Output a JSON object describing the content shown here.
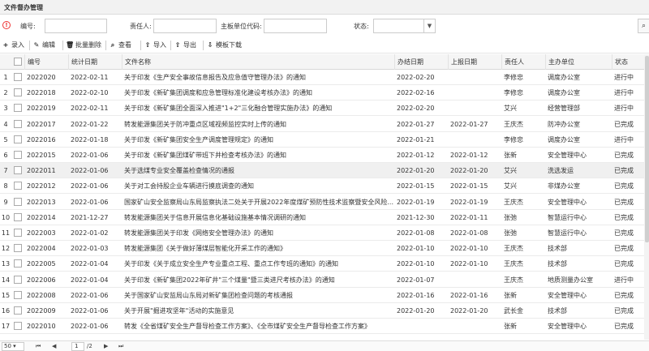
{
  "title": "文件督办管理",
  "filters": {
    "no_label": "编号:",
    "owner_label": "责任人:",
    "unit_code_label": "主板单位代码:",
    "status_label": "状态:"
  },
  "toolbar": {
    "add": "录入",
    "edit": "编辑",
    "batch_delete": "批量删除",
    "view": "查看",
    "import": "导入",
    "export": "导出",
    "template": "模板下载"
  },
  "columns": [
    "编号",
    "统计日期",
    "文件名称",
    "办结日期",
    "上报日期",
    "责任人",
    "主办单位",
    "状态"
  ],
  "rows": [
    {
      "n": "1",
      "id": "2022020",
      "stat": "2022-02-11",
      "name": "关于印发《生产安全事故信息报告及应急值守管理办法》的通知",
      "done": "2022-02-20",
      "report": "",
      "owner": "李修忠",
      "unit": "调度办公室",
      "status": "进行中"
    },
    {
      "n": "2",
      "id": "2022018",
      "stat": "2022-02-10",
      "name": "关于印发《新矿集团调度和应急管理标准化建设考核办法》的通知",
      "done": "2022-02-16",
      "report": "",
      "owner": "李修忠",
      "unit": "调度办公室",
      "status": "进行中"
    },
    {
      "n": "3",
      "id": "2022019",
      "stat": "2022-02-11",
      "name": "关于印发《新矿集团全面深入推进\"1+2\"三化融合管理实施办法》的通知",
      "done": "2022-02-20",
      "report": "",
      "owner": "艾兴",
      "unit": "经营管理部",
      "status": "进行中"
    },
    {
      "n": "4",
      "id": "2022017",
      "stat": "2022-01-22",
      "name": "转发能源集团关于防冲重点区域视频监控实时上传的通知",
      "done": "2022-01-27",
      "report": "2022-01-27",
      "owner": "王庆杰",
      "unit": "防冲办公室",
      "status": "已完成"
    },
    {
      "n": "5",
      "id": "2022016",
      "stat": "2022-01-18",
      "name": "关于印发《新矿集团安全生产调度管理规定》的通知",
      "done": "2022-01-21",
      "report": "",
      "owner": "李修忠",
      "unit": "调度办公室",
      "status": "进行中"
    },
    {
      "n": "6",
      "id": "2022015",
      "stat": "2022-01-06",
      "name": "关于印发《新矿集团煤矿带班下井检查考核办法》的通知",
      "done": "2022-01-12",
      "report": "2022-01-12",
      "owner": "张新",
      "unit": "安全管理中心",
      "status": "已完成"
    },
    {
      "n": "7",
      "id": "2022011",
      "stat": "2022-01-06",
      "name": "关于选煤专业安全覆盖检查情况的通报",
      "done": "2022-01-20",
      "report": "2022-01-20",
      "owner": "艾兴",
      "unit": "洗选发运",
      "status": "已完成"
    },
    {
      "n": "8",
      "id": "2022012",
      "stat": "2022-01-06",
      "name": "关于对工会持股企业车辆进行摸底调查的通知",
      "done": "2022-01-15",
      "report": "2022-01-15",
      "owner": "艾兴",
      "unit": "非煤办公室",
      "status": "已完成"
    },
    {
      "n": "9",
      "id": "2022013",
      "stat": "2022-01-06",
      "name": "国家矿山安全监察局山东局监察执法二处关于开展2022年度煤矿预防性技术监察暨安全风险...",
      "done": "2022-01-19",
      "report": "2022-01-19",
      "owner": "王庆杰",
      "unit": "安全管理中心",
      "status": "已完成"
    },
    {
      "n": "10",
      "id": "2022014",
      "stat": "2021-12-27",
      "name": "转发能源集团关于信息开展信息化基础设施基本情况调研的通知",
      "done": "2021-12-30",
      "report": "2022-01-11",
      "owner": "张弛",
      "unit": "智慧运行中心",
      "status": "已完成"
    },
    {
      "n": "11",
      "id": "2022003",
      "stat": "2022-01-02",
      "name": "转发能源集团关于印发《网络安全管理办法》的通知",
      "done": "2022-01-08",
      "report": "2022-01-08",
      "owner": "张弛",
      "unit": "智慧运行中心",
      "status": "已完成"
    },
    {
      "n": "12",
      "id": "2022004",
      "stat": "2022-01-03",
      "name": "转发能源集团《关于做好薄煤层智能化开采工作的通知》",
      "done": "2022-01-10",
      "report": "2022-01-10",
      "owner": "王庆杰",
      "unit": "技术部",
      "status": "已完成"
    },
    {
      "n": "13",
      "id": "2022005",
      "stat": "2022-01-04",
      "name": "关于印发《关于成立安全生产专业重点工程、重点工作专班的通知》的通知",
      "done": "2022-01-10",
      "report": "2022-01-10",
      "owner": "王庆杰",
      "unit": "技术部",
      "status": "已完成"
    },
    {
      "n": "14",
      "id": "2022006",
      "stat": "2022-01-04",
      "name": "关于印发《新矿集团2022年矿井\"三个煤量\"暨三类进尺考核办法》的通知",
      "done": "2022-01-07",
      "report": "",
      "owner": "王庆杰",
      "unit": "地质测量办公室",
      "status": "进行中"
    },
    {
      "n": "15",
      "id": "2022008",
      "stat": "2022-01-06",
      "name": "关于国家矿山安监局山东局对新矿集团检查问题的考核通报",
      "done": "2022-01-16",
      "report": "2022-01-16",
      "owner": "张新",
      "unit": "安全管理中心",
      "status": "已完成"
    },
    {
      "n": "16",
      "id": "2022009",
      "stat": "2022-01-06",
      "name": "关于开展\"掘进攻坚年\"活动的实施意见",
      "done": "2022-01-20",
      "report": "2022-01-20",
      "owner": "武长金",
      "unit": "技术部",
      "status": "已完成"
    },
    {
      "n": "17",
      "id": "2022010",
      "stat": "2022-01-06",
      "name": "转发《全省煤矿安全生产督导检查工作方案》、《全市煤矿安全生产督导检查工作方案》",
      "done": "",
      "report": "",
      "owner": "张新",
      "unit": "安全管理中心",
      "status": "已完成"
    }
  ],
  "pager": {
    "page_size": "50",
    "current_page": "1",
    "total": "/2"
  }
}
